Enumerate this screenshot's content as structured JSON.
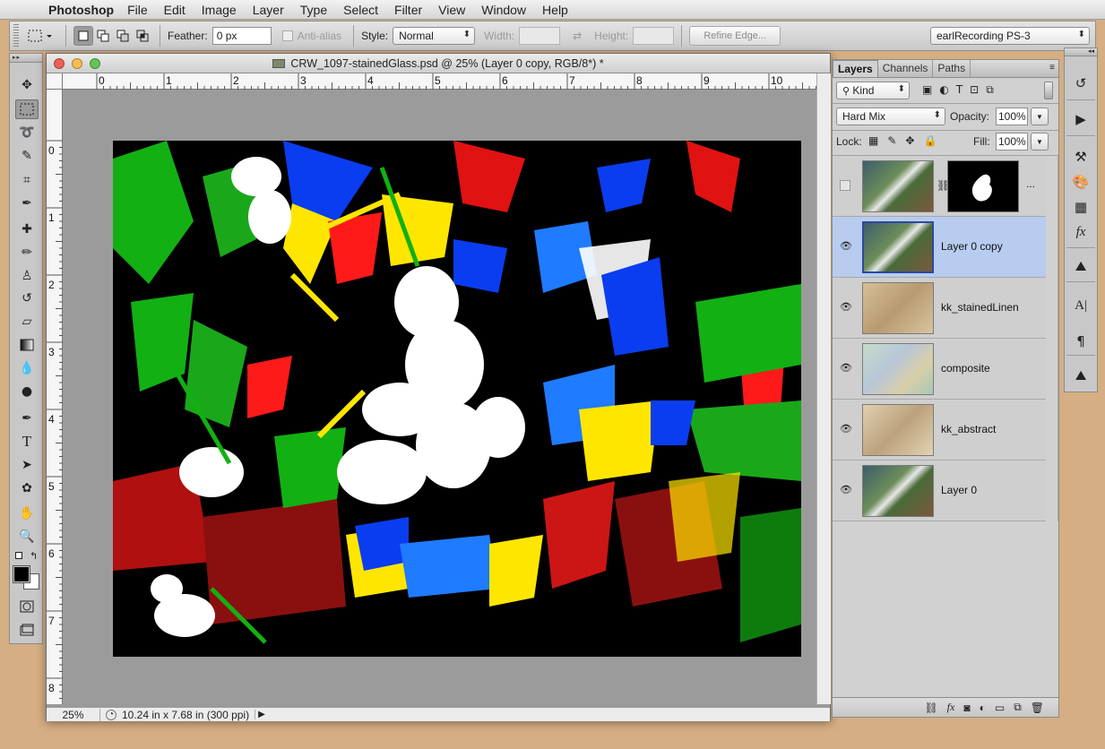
{
  "menubar": {
    "apple_icon": "apple-icon",
    "app_name": "Photoshop",
    "items": [
      "File",
      "Edit",
      "Image",
      "Layer",
      "Type",
      "Select",
      "Filter",
      "View",
      "Window",
      "Help"
    ]
  },
  "options_bar": {
    "feather_label": "Feather:",
    "feather_value": "0 px",
    "antialias_label": "Anti-alias",
    "style_label": "Style:",
    "style_value": "Normal",
    "width_label": "Width:",
    "height_label": "Height:",
    "refine_edge_label": "Refine Edge...",
    "workspace_value": "earlRecording PS-3"
  },
  "document": {
    "title": "CRW_1097-stainedGlass.psd @ 25% (Layer 0 copy, RGB/8*) *",
    "zoom": "25%",
    "doc_info": "10.24 in x 7.68 in (300 ppi)",
    "ruler_h": [
      "0",
      "1",
      "2",
      "3",
      "4",
      "5",
      "6",
      "7",
      "8",
      "9",
      "10"
    ],
    "ruler_v": [
      "0",
      "1",
      "2",
      "3",
      "4",
      "5",
      "6",
      "7",
      "8"
    ]
  },
  "layers_panel": {
    "tabs": [
      "Layers",
      "Channels",
      "Paths"
    ],
    "filter_kind": "Kind",
    "blend_mode": "Hard Mix",
    "opacity_label": "Opacity:",
    "opacity_value": "100%",
    "lock_label": "Lock:",
    "fill_label": "Fill:",
    "fill_value": "100%",
    "mask_ellipsis": "...",
    "layers": [
      {
        "name": "Layer 0 copy",
        "selected": true
      },
      {
        "name": "kk_stainedLinen",
        "selected": false
      },
      {
        "name": "composite",
        "selected": false
      },
      {
        "name": "kk_abstract",
        "selected": false
      },
      {
        "name": "Layer 0",
        "selected": false
      }
    ]
  },
  "colors": {
    "desktop": "#d5ae83",
    "selection_highlight": "#b8ccf0",
    "panel_bg": "#d1d1d1"
  }
}
